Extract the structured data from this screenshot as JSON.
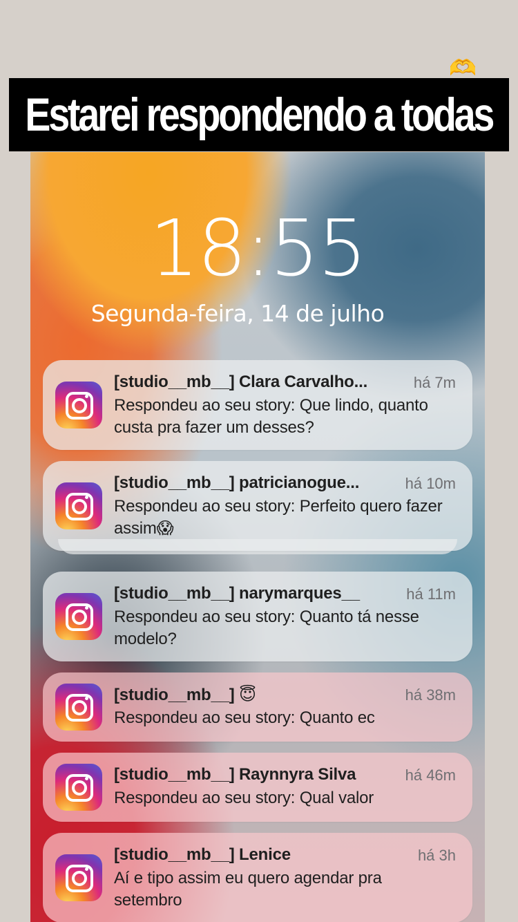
{
  "overlay": {
    "banner_text": "Estarei respondendo a todas",
    "hearts_emoji": "🫶"
  },
  "lockscreen": {
    "time": "18:55",
    "date": "Segunda-feira, 14 de julho"
  },
  "notifications": [
    {
      "icon": "instagram-icon",
      "title": "[studio__mb__] Clara Carvalho...",
      "time": "há 7m",
      "body": "Respondeu ao seu story: Que lindo, quanto custa  pra fazer um desses?"
    },
    {
      "icon": "instagram-icon",
      "title": "[studio__mb__] patricianogue...",
      "time": "há 10m",
      "body": "Respondeu ao seu story: Perfeito quero fazer assim😱"
    },
    {
      "icon": "instagram-icon",
      "title": "[studio__mb__] narymarques__",
      "time": "há 11m",
      "body": "Respondeu ao seu story: Quanto tá nesse modelo?"
    },
    {
      "icon": "instagram-icon",
      "title": "[studio__mb__] 😇",
      "time": "há 38m",
      "body": "Respondeu ao seu story: Quanto ec"
    },
    {
      "icon": "instagram-icon",
      "title": "[studio__mb__] Raynnyra Silva",
      "time": "há 46m",
      "body": "Respondeu ao seu story: Qual valor"
    },
    {
      "icon": "instagram-icon",
      "title": "[studio__mb__] Lenice",
      "time": "há 3h",
      "body": "Aí e tipo assim eu quero agendar pra setembro"
    }
  ]
}
